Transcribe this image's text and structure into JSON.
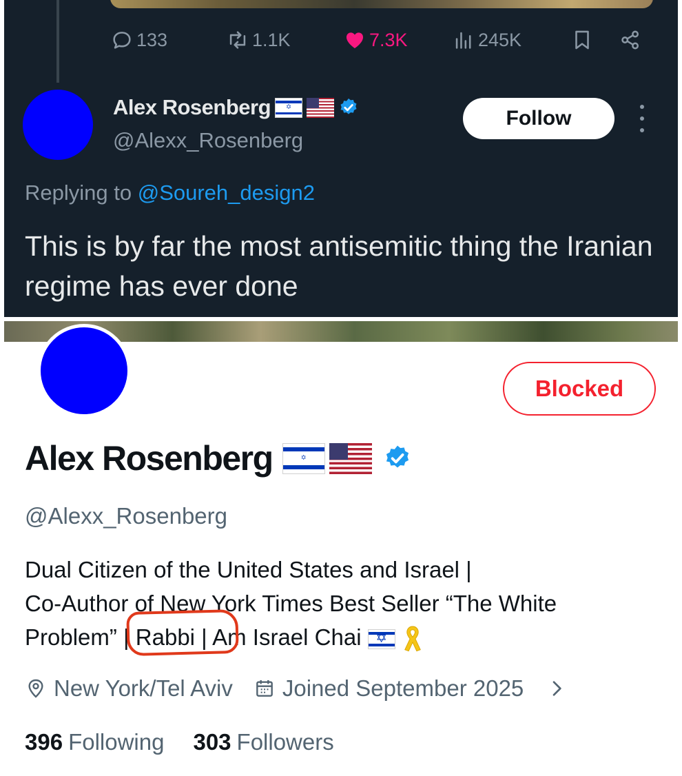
{
  "tweet": {
    "actions": {
      "replies": "133",
      "retweets": "1.1K",
      "likes": "7.3K",
      "views": "245K"
    },
    "author": {
      "name": "Alex Rosenberg",
      "handle": "@Alexx_Rosenberg",
      "flags": [
        "israel-flag",
        "us-flag"
      ],
      "verified": true
    },
    "follow_label": "Follow",
    "replying_prefix": "Replying to",
    "replying_to": "@Soureh_design2",
    "text": "This is by far the most antisemitic thing the Iranian regime has ever done"
  },
  "profile": {
    "name": "Alex Rosenberg",
    "handle": "@Alexx_Rosenberg",
    "blocked_label": "Blocked",
    "bio_line1": "Dual Citizen of the United States and Israel |",
    "bio_line2": "Co-Author of New York Times Best Seller “The White",
    "bio_line3_a": "Problem”",
    "bio_line3_b": "| Rabbi |",
    "bio_line3_c": "Am Israel Chai",
    "location": "New York/Tel Aviv",
    "joined": "Joined September 2025",
    "following_count": "396",
    "following_label": "Following",
    "followers_count": "303",
    "followers_label": "Followers"
  },
  "colors": {
    "dark_bg": "#15202b",
    "like_pink": "#f91880",
    "link_blue": "#1d9bf0",
    "blocked_red": "#f4212e",
    "annotation_red": "#e0391b",
    "verified_blue": "#1d9bf0"
  },
  "icons": [
    "reply-icon",
    "retweet-icon",
    "heart-icon",
    "views-icon",
    "bookmark-icon",
    "share-icon",
    "verified-icon",
    "location-icon",
    "calendar-icon",
    "chevron-right-icon",
    "yellow-ribbon-icon"
  ]
}
